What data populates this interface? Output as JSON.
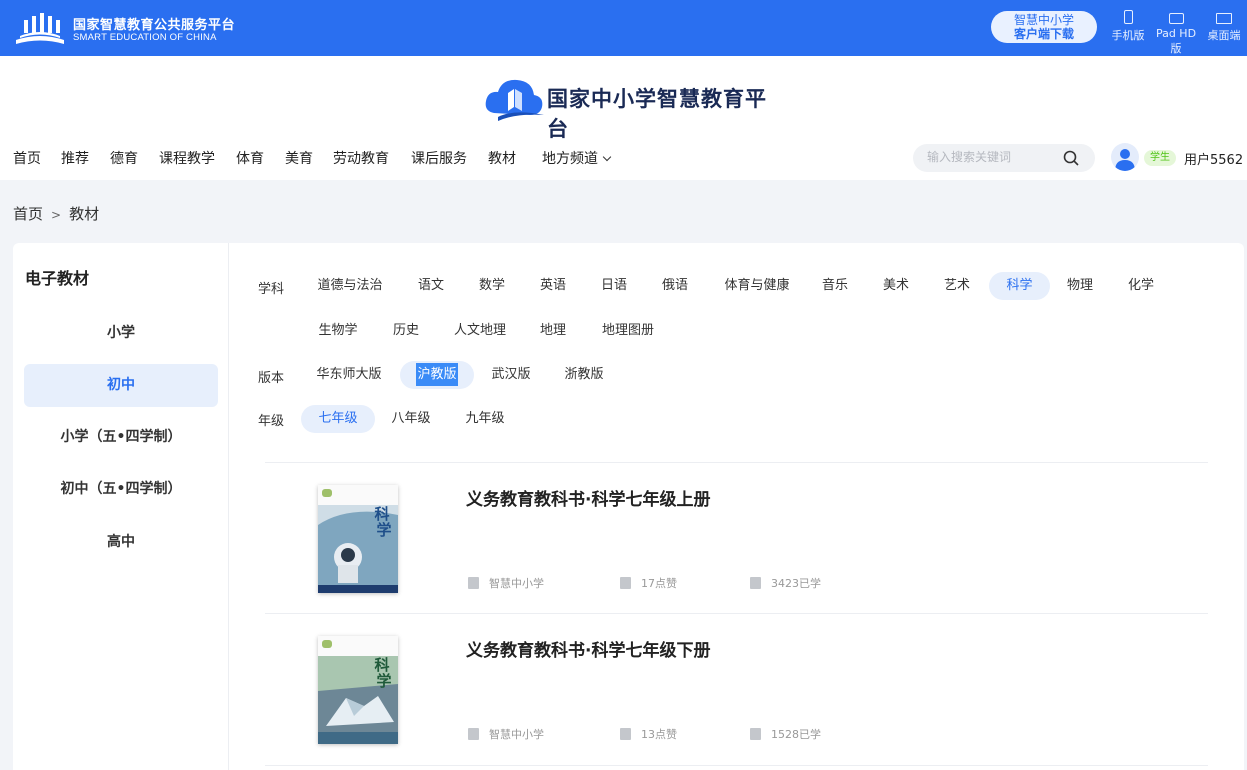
{
  "topbar": {
    "title": "国家智慧教育公共服务平台",
    "subtitle": "SMART EDUCATION OF CHINA",
    "download_line1": "智慧中小学",
    "download_line2": "客户端下载",
    "devices": [
      {
        "label": "手机版",
        "icon": "phone-icon"
      },
      {
        "label": "Pad HD版",
        "icon": "tablet-icon"
      },
      {
        "label": "桌面端",
        "icon": "desktop-icon"
      }
    ]
  },
  "header": {
    "brand": "国家中小学智慧教育平台",
    "nav": [
      "首页",
      "推荐",
      "德育",
      "课程教学",
      "体育",
      "美育",
      "劳动教育",
      "课后服务",
      "教材",
      "地方频道"
    ],
    "search_placeholder": "输入搜索关键词",
    "role": "学生",
    "username": "用户5562"
  },
  "breadcrumb": [
    "首页",
    "教材"
  ],
  "sidebar": {
    "title": "电子教材",
    "items": [
      "小学",
      "初中",
      "小学（五•四学制）",
      "初中（五•四学制）",
      "高中"
    ],
    "active_index": 1
  },
  "filters": {
    "subject_label": "学科",
    "subjects_row1": [
      "道德与法治",
      "语文",
      "数学",
      "英语",
      "日语",
      "俄语",
      "体育与健康",
      "音乐",
      "美术",
      "艺术",
      "科学",
      "物理",
      "化学"
    ],
    "subjects_row2": [
      "生物学",
      "历史",
      "人文地理",
      "地理",
      "地理图册"
    ],
    "active_subject": "科学",
    "edition_label": "版本",
    "editions": [
      "华东师大版",
      "沪教版",
      "武汉版",
      "浙教版"
    ],
    "active_edition": "沪教版",
    "grade_label": "年级",
    "grades": [
      "七年级",
      "八年级",
      "九年级"
    ],
    "active_grade": "七年级"
  },
  "books": [
    {
      "title": "义务教育教科书·科学七年级上册",
      "publisher": "智慧中小学",
      "likes": "17点赞",
      "learners": "3423已学",
      "cover_char1": "科",
      "cover_char2": "学"
    },
    {
      "title": "义务教育教科书·科学七年级下册",
      "publisher": "智慧中小学",
      "likes": "13点赞",
      "learners": "1528已学",
      "cover_char1": "科",
      "cover_char2": "学"
    }
  ],
  "colors": {
    "primary": "#2a6ff0",
    "active_bg": "#e7effc",
    "page_bg": "#f2f4f8"
  }
}
